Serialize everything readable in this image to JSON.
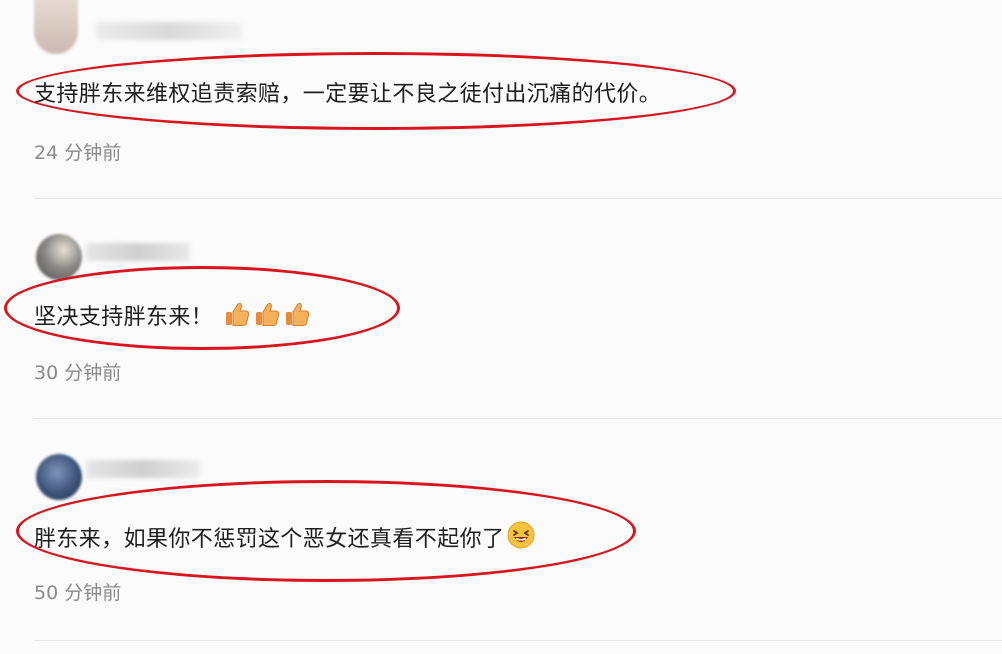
{
  "comments": [
    {
      "text": "支持胖东来维权追责索赔，一定要让不良之徒付出沉痛的代价。",
      "time": "24 分钟前"
    },
    {
      "text": "坚决支持胖东来！",
      "time": "30 分钟前",
      "emoji": [
        "thumbs-up-icon",
        "thumbs-up-icon",
        "thumbs-up-icon"
      ]
    },
    {
      "text": "胖东来，如果你不惩罚这个恶女还真看不起你了",
      "time": "50 分钟前",
      "emoji": [
        "laughing-face-icon"
      ]
    }
  ],
  "colors": {
    "highlight_ellipse": "#d9141d",
    "timestamp": "#8a8a8a",
    "divider": "#e8e8ec"
  }
}
